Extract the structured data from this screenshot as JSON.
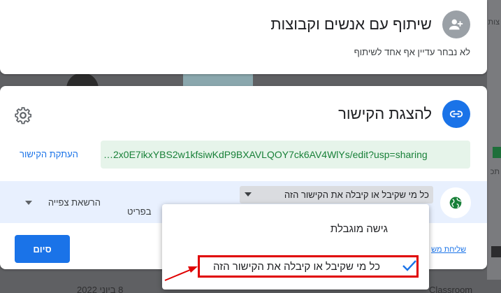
{
  "background": {
    "tab_fragment": "צות",
    "row_fragment": "תכ",
    "bottom_date": "8 ביוני 2022",
    "bottom_app": "Classroom"
  },
  "share_panel": {
    "title": "שיתוף עם אנשים וקבוצות",
    "subtitle": "לא נבחר עדיין אף אחד לשיתוף",
    "icon": "add-person-icon"
  },
  "link_panel": {
    "title": "להצגת הקישור",
    "icon": "link-icon",
    "settings_icon": "gear-icon",
    "url": "…2x0E7ikxYBS2w1kfsiwKdP9BXAVLQOY7ck6AV4WlYs/edit?usp=sharing",
    "copy_link": "העתקת הקישור",
    "access_icon": "globe-icon",
    "access_value": "כל מי שקיבל או קיבלה את הקישור הזה",
    "role_value": "הרשאת צפייה",
    "access_desc_partial": "בפריט",
    "done": "סיום",
    "feedback_partial": "שליחת משוב"
  },
  "access_menu": {
    "items": [
      {
        "label": "גישה מוגבלת",
        "selected": false
      },
      {
        "label": "כל מי שקיבל או קיבלה את הקישור הזה",
        "selected": true
      }
    ],
    "check_icon": "check-icon",
    "highlight_color": "#e00000"
  },
  "colors": {
    "accent": "#1a73e8",
    "url_text": "#188038",
    "url_bg": "#e6f4ea",
    "access_row_bg": "#e8f0fe"
  }
}
